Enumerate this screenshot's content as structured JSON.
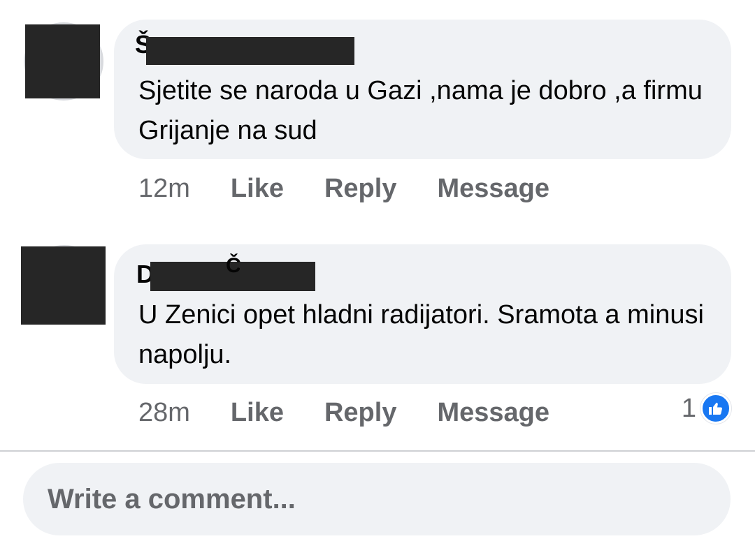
{
  "comments": [
    {
      "name_visible": "Š",
      "text": "Sjetite se naroda u Gazi ,nama je dobro ,a firmu Grijanje na sud",
      "time": "12m",
      "actions": {
        "like": "Like",
        "reply": "Reply",
        "message": "Message"
      }
    },
    {
      "name_visible": "D",
      "name_visible_2": "Č",
      "text": "U Zenici opet hladni radijatori. Sramota a minusi napolju.",
      "time": "28m",
      "actions": {
        "like": "Like",
        "reply": "Reply",
        "message": "Message"
      },
      "reaction_count": "1",
      "reaction_icon": "thumbs-up-icon"
    }
  ],
  "composer": {
    "placeholder": "Write a comment..."
  },
  "colors": {
    "bubble": "#f0f2f5",
    "meta": "#65676b",
    "like_blue": "#1877f2"
  }
}
